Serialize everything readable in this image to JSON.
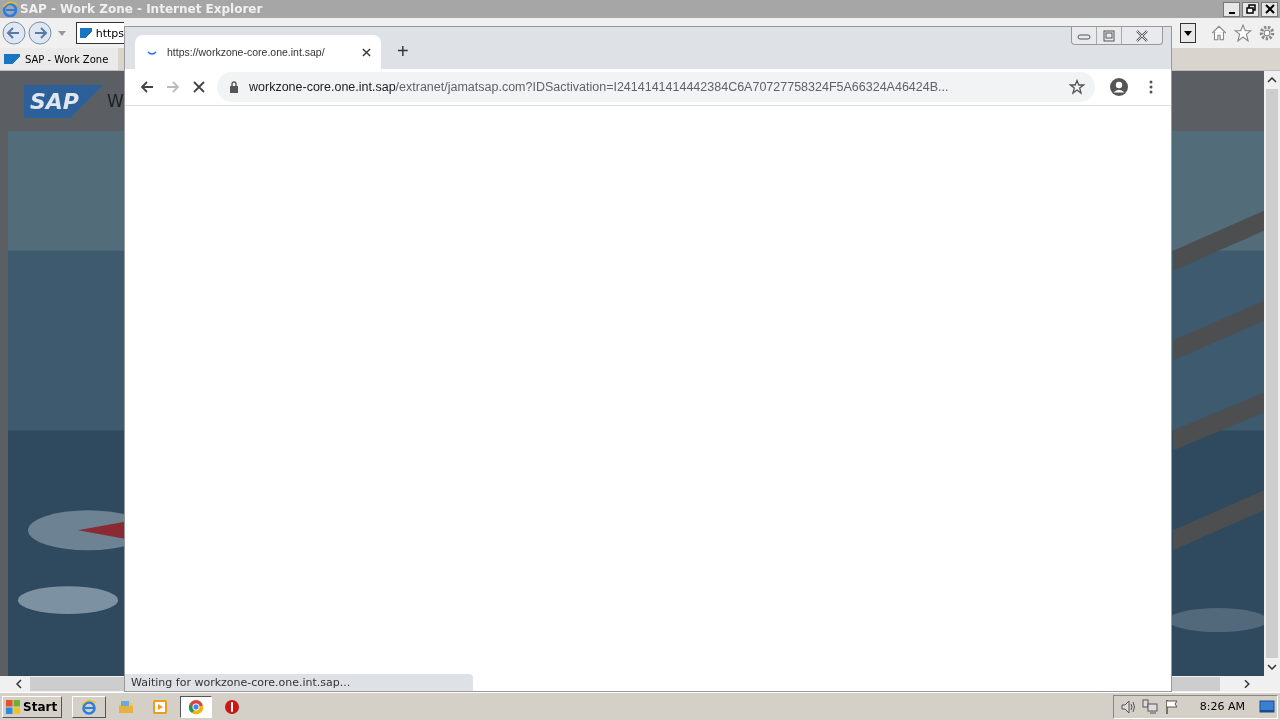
{
  "ie_window": {
    "title": "SAP - Work Zone - Internet Explorer",
    "address_text": "https",
    "tab_title": "SAP - Work Zone"
  },
  "page": {
    "logo": "SAP",
    "heading": "W"
  },
  "chrome": {
    "tab_title": "https://workzone-core.one.int.sap/",
    "new_tab": "+",
    "loading": true,
    "url_host": "workzone-core.one.int.sap",
    "url_path": "/extranet/jamatsap.com?IDSactivation=I2414141414442384C6A70727758324F5A66324A46424B...",
    "status_text": "Waiting for workzone-core.one.int.sap..."
  },
  "taskbar": {
    "start_label": "Start",
    "apps": [
      {
        "kind": "ie",
        "selected": false
      },
      {
        "kind": "folder",
        "selected": false
      },
      {
        "kind": "media",
        "selected": false
      },
      {
        "kind": "chrome",
        "selected": true
      },
      {
        "kind": "stop",
        "selected": false
      }
    ],
    "clock": "8:26 AM"
  }
}
